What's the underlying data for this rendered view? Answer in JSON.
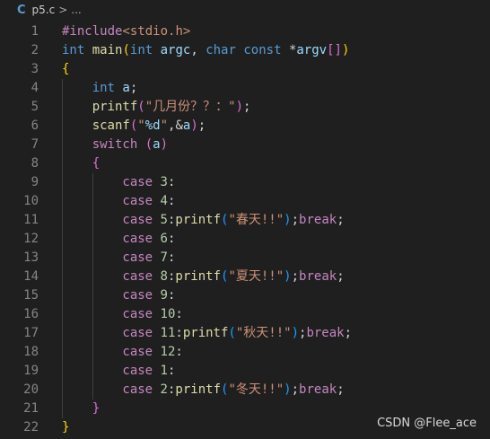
{
  "breadcrumb": {
    "icon": "C",
    "file": "p5.c",
    "separator": ">",
    "more": "..."
  },
  "watermark": "CSDN @Flee_ace",
  "lines": [
    {
      "n": "1",
      "indent": 0,
      "tokens": [
        [
          "#include",
          "pre"
        ],
        [
          "<stdio.h>",
          "str"
        ]
      ]
    },
    {
      "n": "2",
      "indent": 0,
      "tokens": [
        [
          "int",
          "kw"
        ],
        [
          " ",
          "txt"
        ],
        [
          "main",
          "fn"
        ],
        [
          "(",
          "b1"
        ],
        [
          "int",
          "kw"
        ],
        [
          " ",
          "txt"
        ],
        [
          "argc",
          "var"
        ],
        [
          ", ",
          "txt"
        ],
        [
          "char",
          "kw"
        ],
        [
          " ",
          "txt"
        ],
        [
          "const",
          "kw"
        ],
        [
          " *",
          "txt"
        ],
        [
          "argv",
          "var"
        ],
        [
          "[]",
          "b2"
        ],
        [
          ")",
          "b1"
        ]
      ]
    },
    {
      "n": "3",
      "indent": 0,
      "tokens": [
        [
          "{",
          "b1"
        ]
      ]
    },
    {
      "n": "4",
      "indent": 1,
      "tokens": [
        [
          "int",
          "kw"
        ],
        [
          " ",
          "txt"
        ],
        [
          "a",
          "var"
        ],
        [
          ";",
          "txt"
        ]
      ]
    },
    {
      "n": "5",
      "indent": 1,
      "tokens": [
        [
          "printf",
          "fn"
        ],
        [
          "(",
          "b2"
        ],
        [
          "\"几月份？？：\"",
          "str"
        ],
        [
          ")",
          "b2"
        ],
        [
          ";",
          "txt"
        ]
      ]
    },
    {
      "n": "6",
      "indent": 1,
      "tokens": [
        [
          "scanf",
          "fn"
        ],
        [
          "(",
          "b2"
        ],
        [
          "\"",
          "str"
        ],
        [
          "%d",
          "esc"
        ],
        [
          "\"",
          "str"
        ],
        [
          ",&",
          "txt"
        ],
        [
          "a",
          "var"
        ],
        [
          ")",
          "b2"
        ],
        [
          ";",
          "txt"
        ]
      ]
    },
    {
      "n": "7",
      "indent": 1,
      "tokens": [
        [
          "switch",
          "ctl"
        ],
        [
          " ",
          "txt"
        ],
        [
          "(",
          "b2"
        ],
        [
          "a",
          "var"
        ],
        [
          ")",
          "b2"
        ]
      ]
    },
    {
      "n": "8",
      "indent": 1,
      "tokens": [
        [
          "{",
          "b2"
        ]
      ]
    },
    {
      "n": "9",
      "indent": 2,
      "tokens": [
        [
          "case",
          "ctl"
        ],
        [
          " ",
          "txt"
        ],
        [
          "3",
          "num"
        ],
        [
          ":",
          "txt"
        ]
      ]
    },
    {
      "n": "10",
      "indent": 2,
      "tokens": [
        [
          "case",
          "ctl"
        ],
        [
          " ",
          "txt"
        ],
        [
          "4",
          "num"
        ],
        [
          ":",
          "txt"
        ]
      ]
    },
    {
      "n": "11",
      "indent": 2,
      "tokens": [
        [
          "case",
          "ctl"
        ],
        [
          " ",
          "txt"
        ],
        [
          "5",
          "num"
        ],
        [
          ":",
          "txt"
        ],
        [
          "printf",
          "fn"
        ],
        [
          "(",
          "b3"
        ],
        [
          "\"春天!!\"",
          "str"
        ],
        [
          ")",
          "b3"
        ],
        [
          ";",
          "txt"
        ],
        [
          "break",
          "ctl"
        ],
        [
          ";",
          "txt"
        ]
      ]
    },
    {
      "n": "12",
      "indent": 2,
      "tokens": [
        [
          "case",
          "ctl"
        ],
        [
          " ",
          "txt"
        ],
        [
          "6",
          "num"
        ],
        [
          ":",
          "txt"
        ]
      ]
    },
    {
      "n": "13",
      "indent": 2,
      "tokens": [
        [
          "case",
          "ctl"
        ],
        [
          " ",
          "txt"
        ],
        [
          "7",
          "num"
        ],
        [
          ":",
          "txt"
        ]
      ]
    },
    {
      "n": "14",
      "indent": 2,
      "tokens": [
        [
          "case",
          "ctl"
        ],
        [
          " ",
          "txt"
        ],
        [
          "8",
          "num"
        ],
        [
          ":",
          "txt"
        ],
        [
          "printf",
          "fn"
        ],
        [
          "(",
          "b3"
        ],
        [
          "\"夏天!!\"",
          "str"
        ],
        [
          ")",
          "b3"
        ],
        [
          ";",
          "txt"
        ],
        [
          "break",
          "ctl"
        ],
        [
          ";",
          "txt"
        ]
      ]
    },
    {
      "n": "15",
      "indent": 2,
      "tokens": [
        [
          "case",
          "ctl"
        ],
        [
          " ",
          "txt"
        ],
        [
          "9",
          "num"
        ],
        [
          ":",
          "txt"
        ]
      ]
    },
    {
      "n": "16",
      "indent": 2,
      "tokens": [
        [
          "case",
          "ctl"
        ],
        [
          " ",
          "txt"
        ],
        [
          "10",
          "num"
        ],
        [
          ":",
          "txt"
        ]
      ]
    },
    {
      "n": "17",
      "indent": 2,
      "tokens": [
        [
          "case",
          "ctl"
        ],
        [
          " ",
          "txt"
        ],
        [
          "11",
          "num"
        ],
        [
          ":",
          "txt"
        ],
        [
          "printf",
          "fn"
        ],
        [
          "(",
          "b3"
        ],
        [
          "\"秋天!!\"",
          "str"
        ],
        [
          ")",
          "b3"
        ],
        [
          ";",
          "txt"
        ],
        [
          "break",
          "ctl"
        ],
        [
          ";",
          "txt"
        ]
      ]
    },
    {
      "n": "18",
      "indent": 2,
      "tokens": [
        [
          "case",
          "ctl"
        ],
        [
          " ",
          "txt"
        ],
        [
          "12",
          "num"
        ],
        [
          ":",
          "txt"
        ]
      ]
    },
    {
      "n": "19",
      "indent": 2,
      "tokens": [
        [
          "case",
          "ctl"
        ],
        [
          " ",
          "txt"
        ],
        [
          "1",
          "num"
        ],
        [
          ":",
          "txt"
        ]
      ]
    },
    {
      "n": "20",
      "indent": 2,
      "tokens": [
        [
          "case",
          "ctl"
        ],
        [
          " ",
          "txt"
        ],
        [
          "2",
          "num"
        ],
        [
          ":",
          "txt"
        ],
        [
          "printf",
          "fn"
        ],
        [
          "(",
          "b3"
        ],
        [
          "\"冬天!!\"",
          "str"
        ],
        [
          ")",
          "b3"
        ],
        [
          ";",
          "txt"
        ],
        [
          "break",
          "ctl"
        ],
        [
          ";",
          "txt"
        ]
      ]
    },
    {
      "n": "21",
      "indent": 1,
      "tokens": [
        [
          "}",
          "b2"
        ]
      ]
    },
    {
      "n": "22",
      "indent": 0,
      "tokens": [
        [
          "}",
          "b1"
        ]
      ]
    }
  ]
}
